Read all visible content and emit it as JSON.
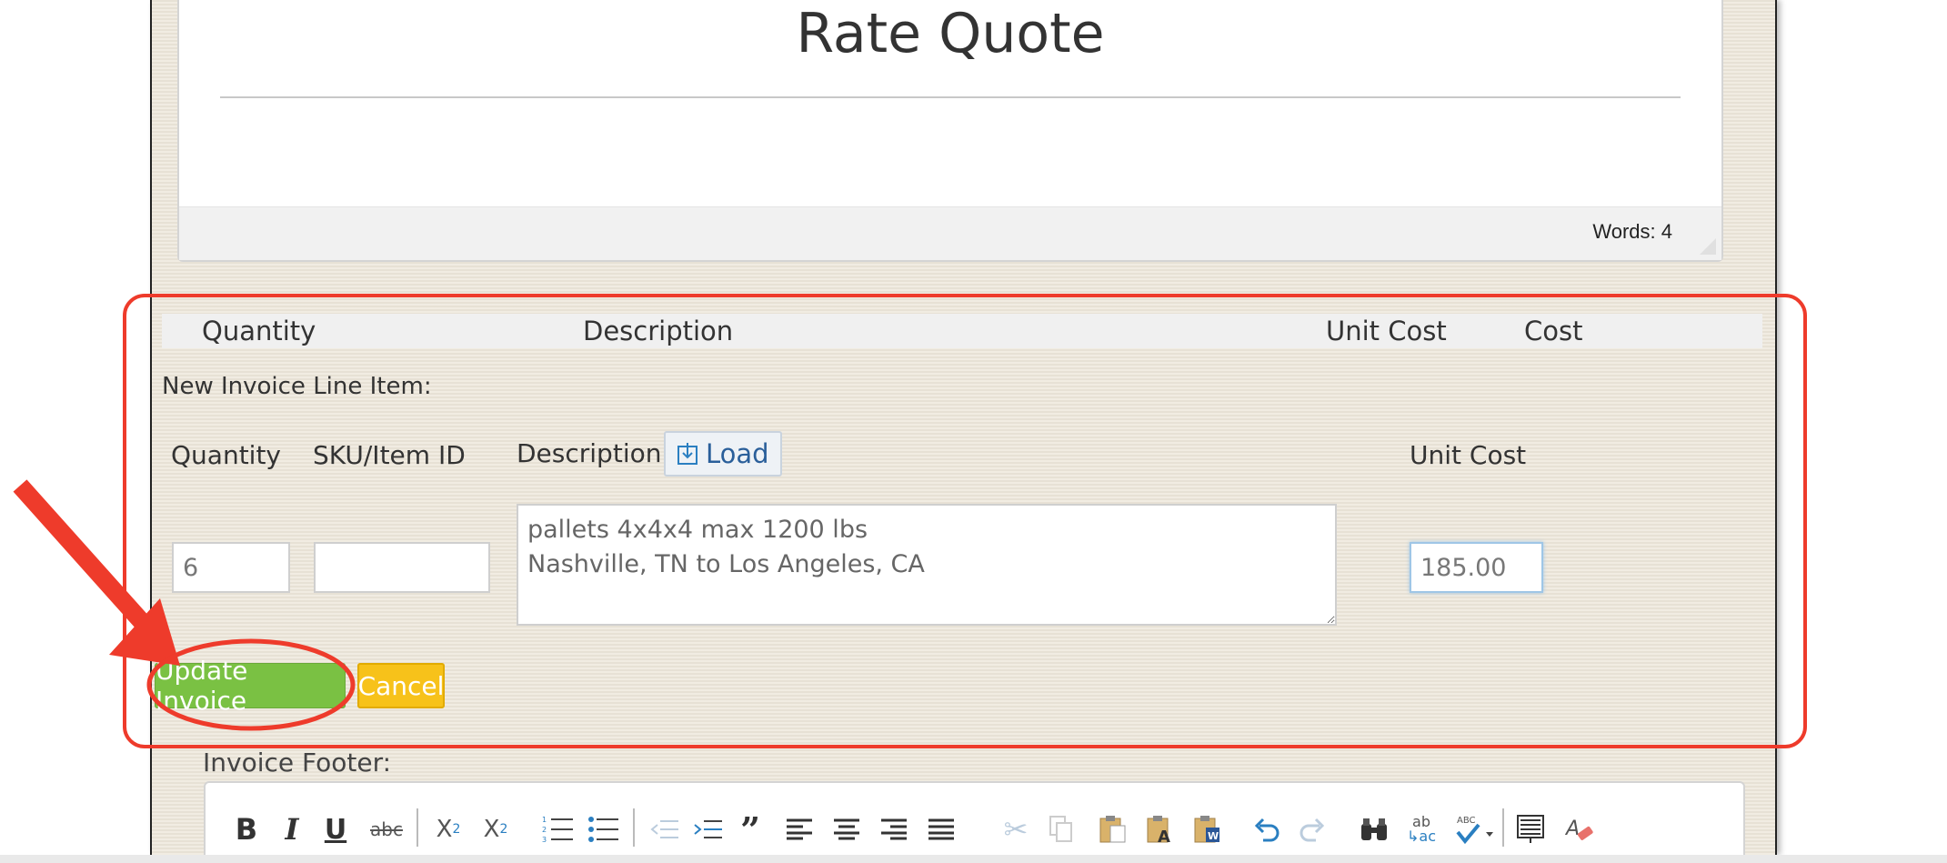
{
  "editor": {
    "title": "Rate Quote",
    "word_count": "Words: 4"
  },
  "table_header": {
    "quantity": "Quantity",
    "description": "Description",
    "unit_cost": "Unit Cost",
    "cost": "Cost"
  },
  "new_item": {
    "heading": "New Invoice Line Item:",
    "quantity_label": "Quantity",
    "sku_label": "SKU/Item ID",
    "description_label": "Description",
    "load_label": "Load",
    "unit_cost_label": "Unit Cost",
    "quantity_value": "6",
    "sku_value": "",
    "description_value": "pallets 4x4x4 max 1200 lbs\nNashville, TN to Los Angeles, CA",
    "unit_cost_value": "185.00"
  },
  "buttons": {
    "update": "Update Invoice",
    "cancel": "Cancel"
  },
  "footer": {
    "label": "Invoice Footer:"
  },
  "colors": {
    "update_button": "#7ac143",
    "cancel_button": "#f7c21a",
    "annotation_red": "#ee3b2b",
    "panel_bg": "#eee8dc"
  },
  "toolbar_icons": [
    "bold-icon",
    "italic-icon",
    "underline-icon",
    "strikethrough-icon",
    "subscript-icon",
    "superscript-icon",
    "numbered-list-icon",
    "bulleted-list-icon",
    "outdent-icon",
    "indent-icon",
    "blockquote-icon",
    "align-left-icon",
    "align-center-icon",
    "align-right-icon",
    "justify-icon",
    "cut-icon",
    "copy-icon",
    "paste-icon",
    "paste-text-icon",
    "paste-word-icon",
    "undo-icon",
    "redo-icon",
    "find-icon",
    "replace-icon",
    "spellcheck-icon",
    "source-icon",
    "remove-format-icon"
  ]
}
